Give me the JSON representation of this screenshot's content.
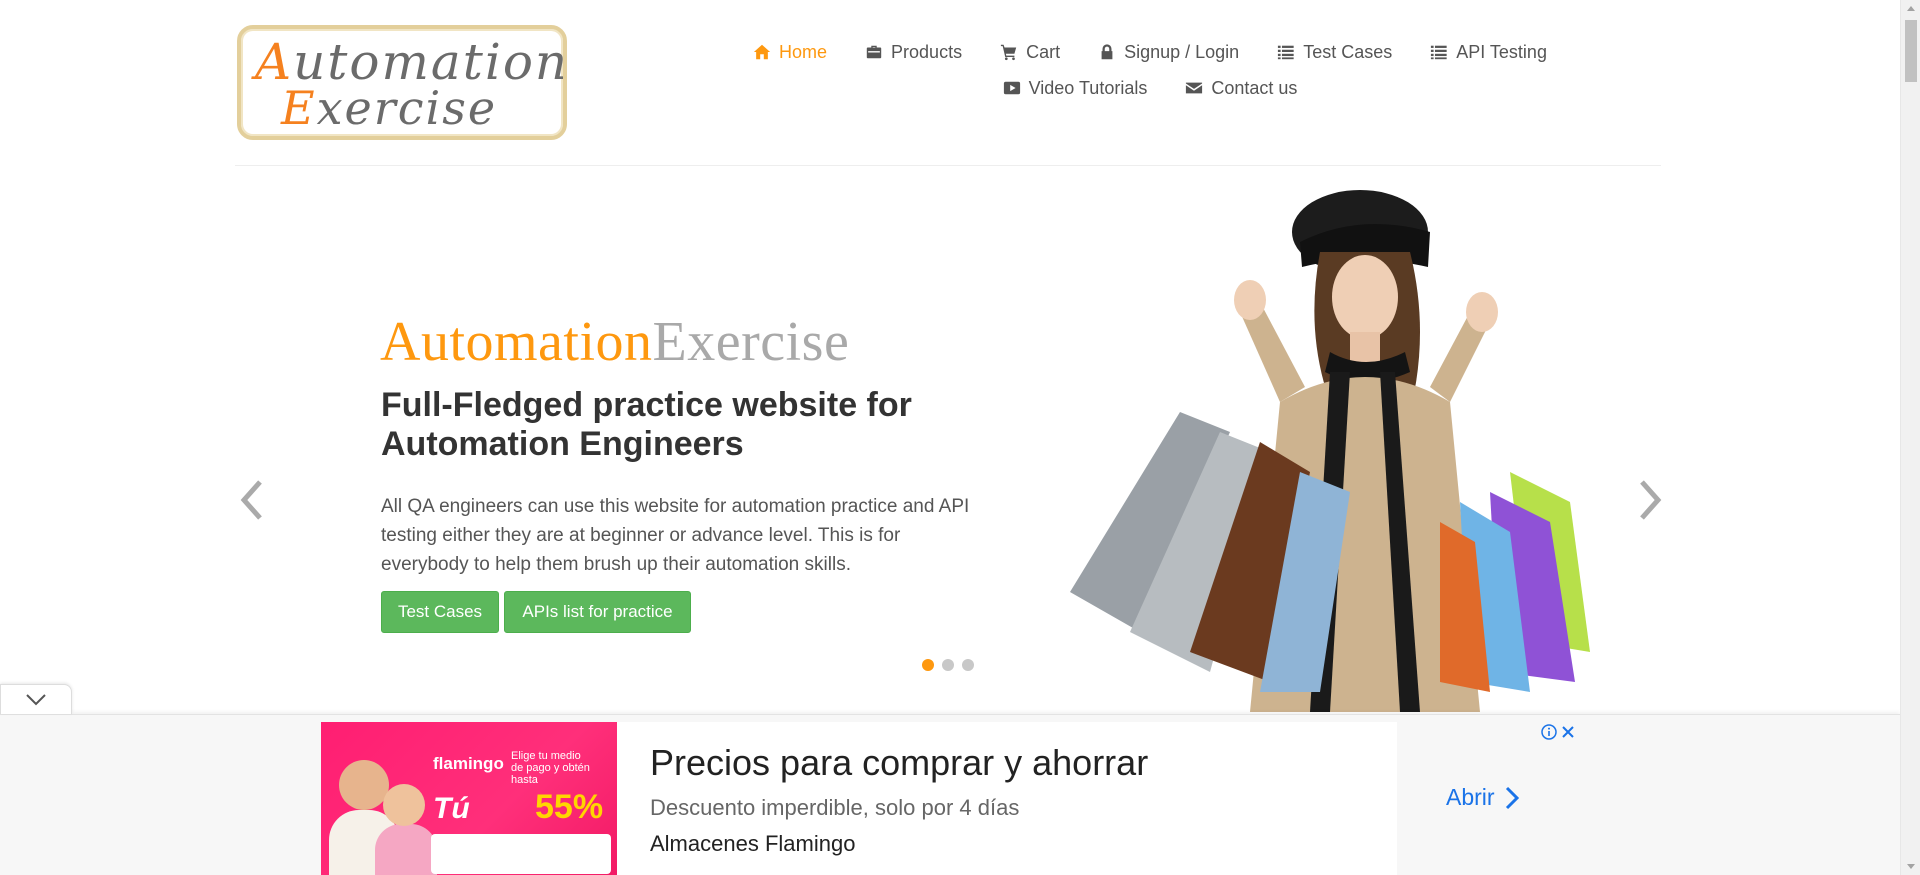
{
  "logo": {
    "line1_cap": "A",
    "line1_rest": "utomation",
    "line2_cap": "E",
    "line2_rest": "xercise"
  },
  "nav": {
    "items": [
      {
        "label": "Home",
        "icon": "home-icon",
        "active": true
      },
      {
        "label": "Products",
        "icon": "briefcase-icon",
        "active": false
      },
      {
        "label": "Cart",
        "icon": "cart-icon",
        "active": false
      },
      {
        "label": "Signup / Login",
        "icon": "lock-icon",
        "active": false
      },
      {
        "label": "Test Cases",
        "icon": "list-icon",
        "active": false
      },
      {
        "label": "API Testing",
        "icon": "list-icon",
        "active": false
      },
      {
        "label": "Video Tutorials",
        "icon": "youtube-play-icon",
        "active": false
      },
      {
        "label": "Contact us",
        "icon": "envelope-icon",
        "active": false
      }
    ]
  },
  "slider": {
    "title_a": "Automation",
    "title_b": "Exercise",
    "heading": "Full-Fledged practice website for Automation Engineers",
    "text": "All QA engineers can use this website for automation practice and API testing either they are at beginner or advance level. This is for everybody to help them brush up their automation skills.",
    "button_test_cases": "Test Cases",
    "button_apis": "APIs list for practice",
    "active_slide": 1,
    "slide_count": 3
  },
  "ad": {
    "headline": "Precios para comprar y ahorrar",
    "description": "Descuento imperdible, solo por 4 días",
    "store": "Almacenes Flamingo",
    "open_label": "Abrir",
    "image": {
      "brand": "flamingo",
      "tagline": "Tú",
      "promo": "Elige tu medio de pago y obtén hasta",
      "discount": "55%"
    }
  },
  "colors": {
    "accent": "#fe980f",
    "button_green": "#5cb85c",
    "ad_pink": "#ff1e72",
    "link_blue": "#1a73e8"
  }
}
